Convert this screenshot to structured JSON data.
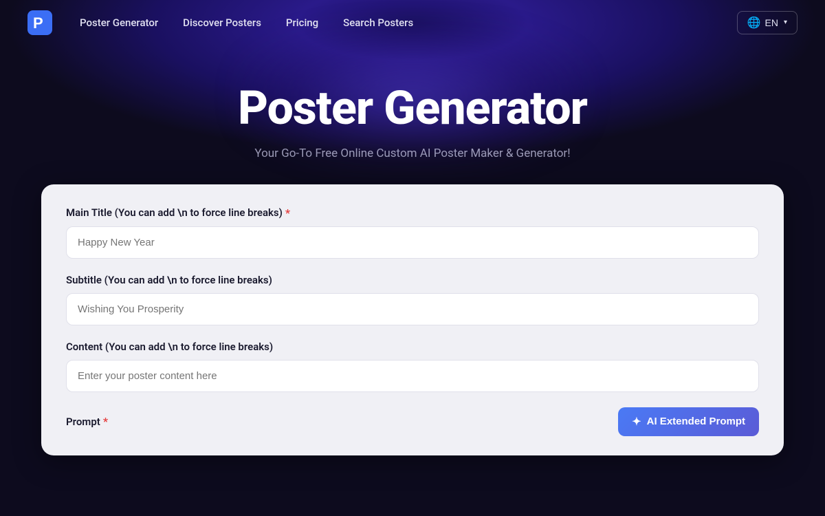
{
  "nav": {
    "links": [
      {
        "label": "Poster Generator",
        "id": "poster-generator"
      },
      {
        "label": "Discover Posters",
        "id": "discover-posters"
      },
      {
        "label": "Pricing",
        "id": "pricing"
      },
      {
        "label": "Search Posters",
        "id": "search-posters"
      }
    ],
    "lang": {
      "code": "EN",
      "icon": "🌐"
    }
  },
  "hero": {
    "title": "Poster Generator",
    "subtitle": "Your Go-To Free Online Custom AI Poster Maker & Generator!"
  },
  "form": {
    "fields": [
      {
        "id": "main-title",
        "label": "Main Title (You can add \\n to force line breaks)",
        "required": true,
        "placeholder": "Happy New Year",
        "type": "text"
      },
      {
        "id": "subtitle",
        "label": "Subtitle (You can add \\n to force line breaks)",
        "required": false,
        "placeholder": "Wishing You Prosperity",
        "type": "text"
      },
      {
        "id": "content",
        "label": "Content (You can add \\n to force line breaks)",
        "required": false,
        "placeholder": "Enter your poster content here",
        "type": "text"
      }
    ],
    "prompt": {
      "label": "Prompt",
      "required": true
    },
    "ai_button": {
      "label": "AI Extended Prompt",
      "icon": "✦"
    }
  }
}
